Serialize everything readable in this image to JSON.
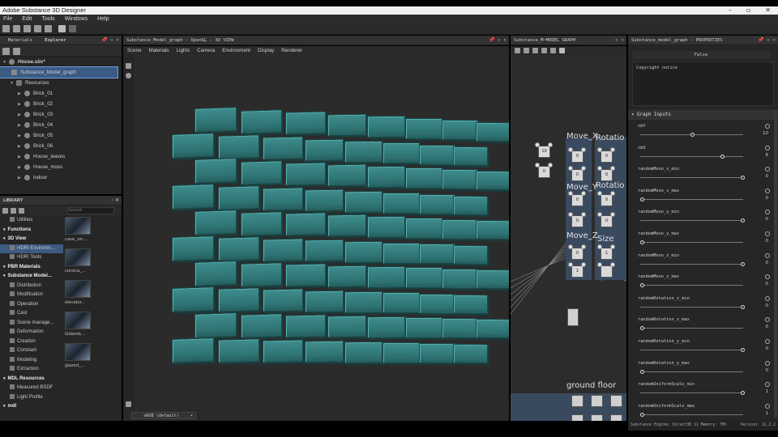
{
  "app": {
    "title": "Adobe Substance 3D Designer"
  },
  "menu": [
    "File",
    "Edit",
    "Tools",
    "Windows",
    "Help"
  ],
  "explorer": {
    "tabs": [
      "Materials",
      "Explorer"
    ],
    "package": "House.sbs*",
    "graph_item": "Substance_Model_graph",
    "resources_label": "Resources",
    "resources": [
      "Brick_01",
      "Brick_02",
      "Brick_03",
      "Brick_04",
      "Brick_05",
      "Brick_06",
      "House_leaves",
      "House_moss",
      "indoor"
    ]
  },
  "library": {
    "title": "LIBRARY",
    "search_placeholder": "Search",
    "categories": [
      {
        "label": "Utilities",
        "head": false
      },
      {
        "label": "Functions",
        "head": true
      },
      {
        "label": "3D View",
        "head": true
      },
      {
        "label": "HDRI Environm...",
        "head": false,
        "selected": true
      },
      {
        "label": "HDRI Tools",
        "head": false
      },
      {
        "label": "PBR Materials",
        "head": true
      },
      {
        "label": "Substance Model...",
        "head": true
      },
      {
        "label": "Distribution",
        "head": false
      },
      {
        "label": "Modification",
        "head": false
      },
      {
        "label": "Operation",
        "head": false
      },
      {
        "label": "Cast",
        "head": false
      },
      {
        "label": "Scene manage...",
        "head": false
      },
      {
        "label": "Deformation",
        "head": false
      },
      {
        "label": "Creation",
        "head": false
      },
      {
        "label": "Constant",
        "head": false
      },
      {
        "label": "Modeling",
        "head": false
      },
      {
        "label": "Extraction",
        "head": false
      },
      {
        "label": "MDL Resources",
        "head": true
      },
      {
        "label": "Measured BSDF",
        "head": false
      },
      {
        "label": "Light Profile",
        "head": false
      },
      {
        "label": "mdl",
        "head": true
      }
    ],
    "thumbs": [
      "cave_en...",
      "corsica_...",
      "elevator...",
      "Gdansk...",
      "glazed_..."
    ]
  },
  "viewport": {
    "title": "Substance_Model_graph - OpenGL - 3D VIEW",
    "menu": [
      "Scene",
      "Materials",
      "Lights",
      "Camera",
      "Environment",
      "Display",
      "Renderer"
    ],
    "colorspace": "sRGB (default)"
  },
  "graph": {
    "title": "Substance_M~MODEL GRAPH",
    "frames": [
      "Move_X",
      "Rotatio",
      "Move_Y",
      "Rotatio",
      "Move_Z",
      "Size",
      "ground floor"
    ],
    "node_values": [
      "10",
      "0",
      "0",
      "0",
      "0",
      "0",
      "0",
      "0",
      "0",
      "0",
      "0",
      "1",
      "1"
    ]
  },
  "properties": {
    "title": "Substance_model_graph - PROPERTIES",
    "false_value": "False",
    "copyright_label": "Copyright notice",
    "section": "Graph Inputs",
    "params": [
      {
        "label": "nbY",
        "value": "10",
        "frac": 0.5
      },
      {
        "label": "nbX",
        "value": "8",
        "frac": 0.8
      },
      {
        "label": "randomMove_x_min",
        "value": "0",
        "frac": 1.0
      },
      {
        "label": "randomMove_x_max",
        "value": "0",
        "frac": 0.0
      },
      {
        "label": "randomMove_y_min",
        "value": "0",
        "frac": 1.0
      },
      {
        "label": "randomMove_y_max",
        "value": "0",
        "frac": 0.0
      },
      {
        "label": "randomMove_z_min",
        "value": "0",
        "frac": 1.0
      },
      {
        "label": "randomMove_z_max",
        "value": "0",
        "frac": 0.0
      },
      {
        "label": "randomRotation_x_min",
        "value": "0",
        "frac": 1.0
      },
      {
        "label": "randomRotation_x_max",
        "value": "0",
        "frac": 0.0
      },
      {
        "label": "randomRotation_y_min",
        "value": "0",
        "frac": 1.0
      },
      {
        "label": "randomRotation_y_max",
        "value": "0",
        "frac": 0.0
      },
      {
        "label": "randomUniformScale_min",
        "value": "1",
        "frac": 1.0
      },
      {
        "label": "randomUniformScale_max",
        "value": "1",
        "frac": 0.0
      }
    ]
  },
  "status": {
    "engine": "Substance Engine: Direct3D 11 Memory: 70%",
    "version": "Version: 11.2.2"
  },
  "colors": {
    "accent": "#3b5b85",
    "brick": "#2f7373",
    "panel": "#262626"
  }
}
